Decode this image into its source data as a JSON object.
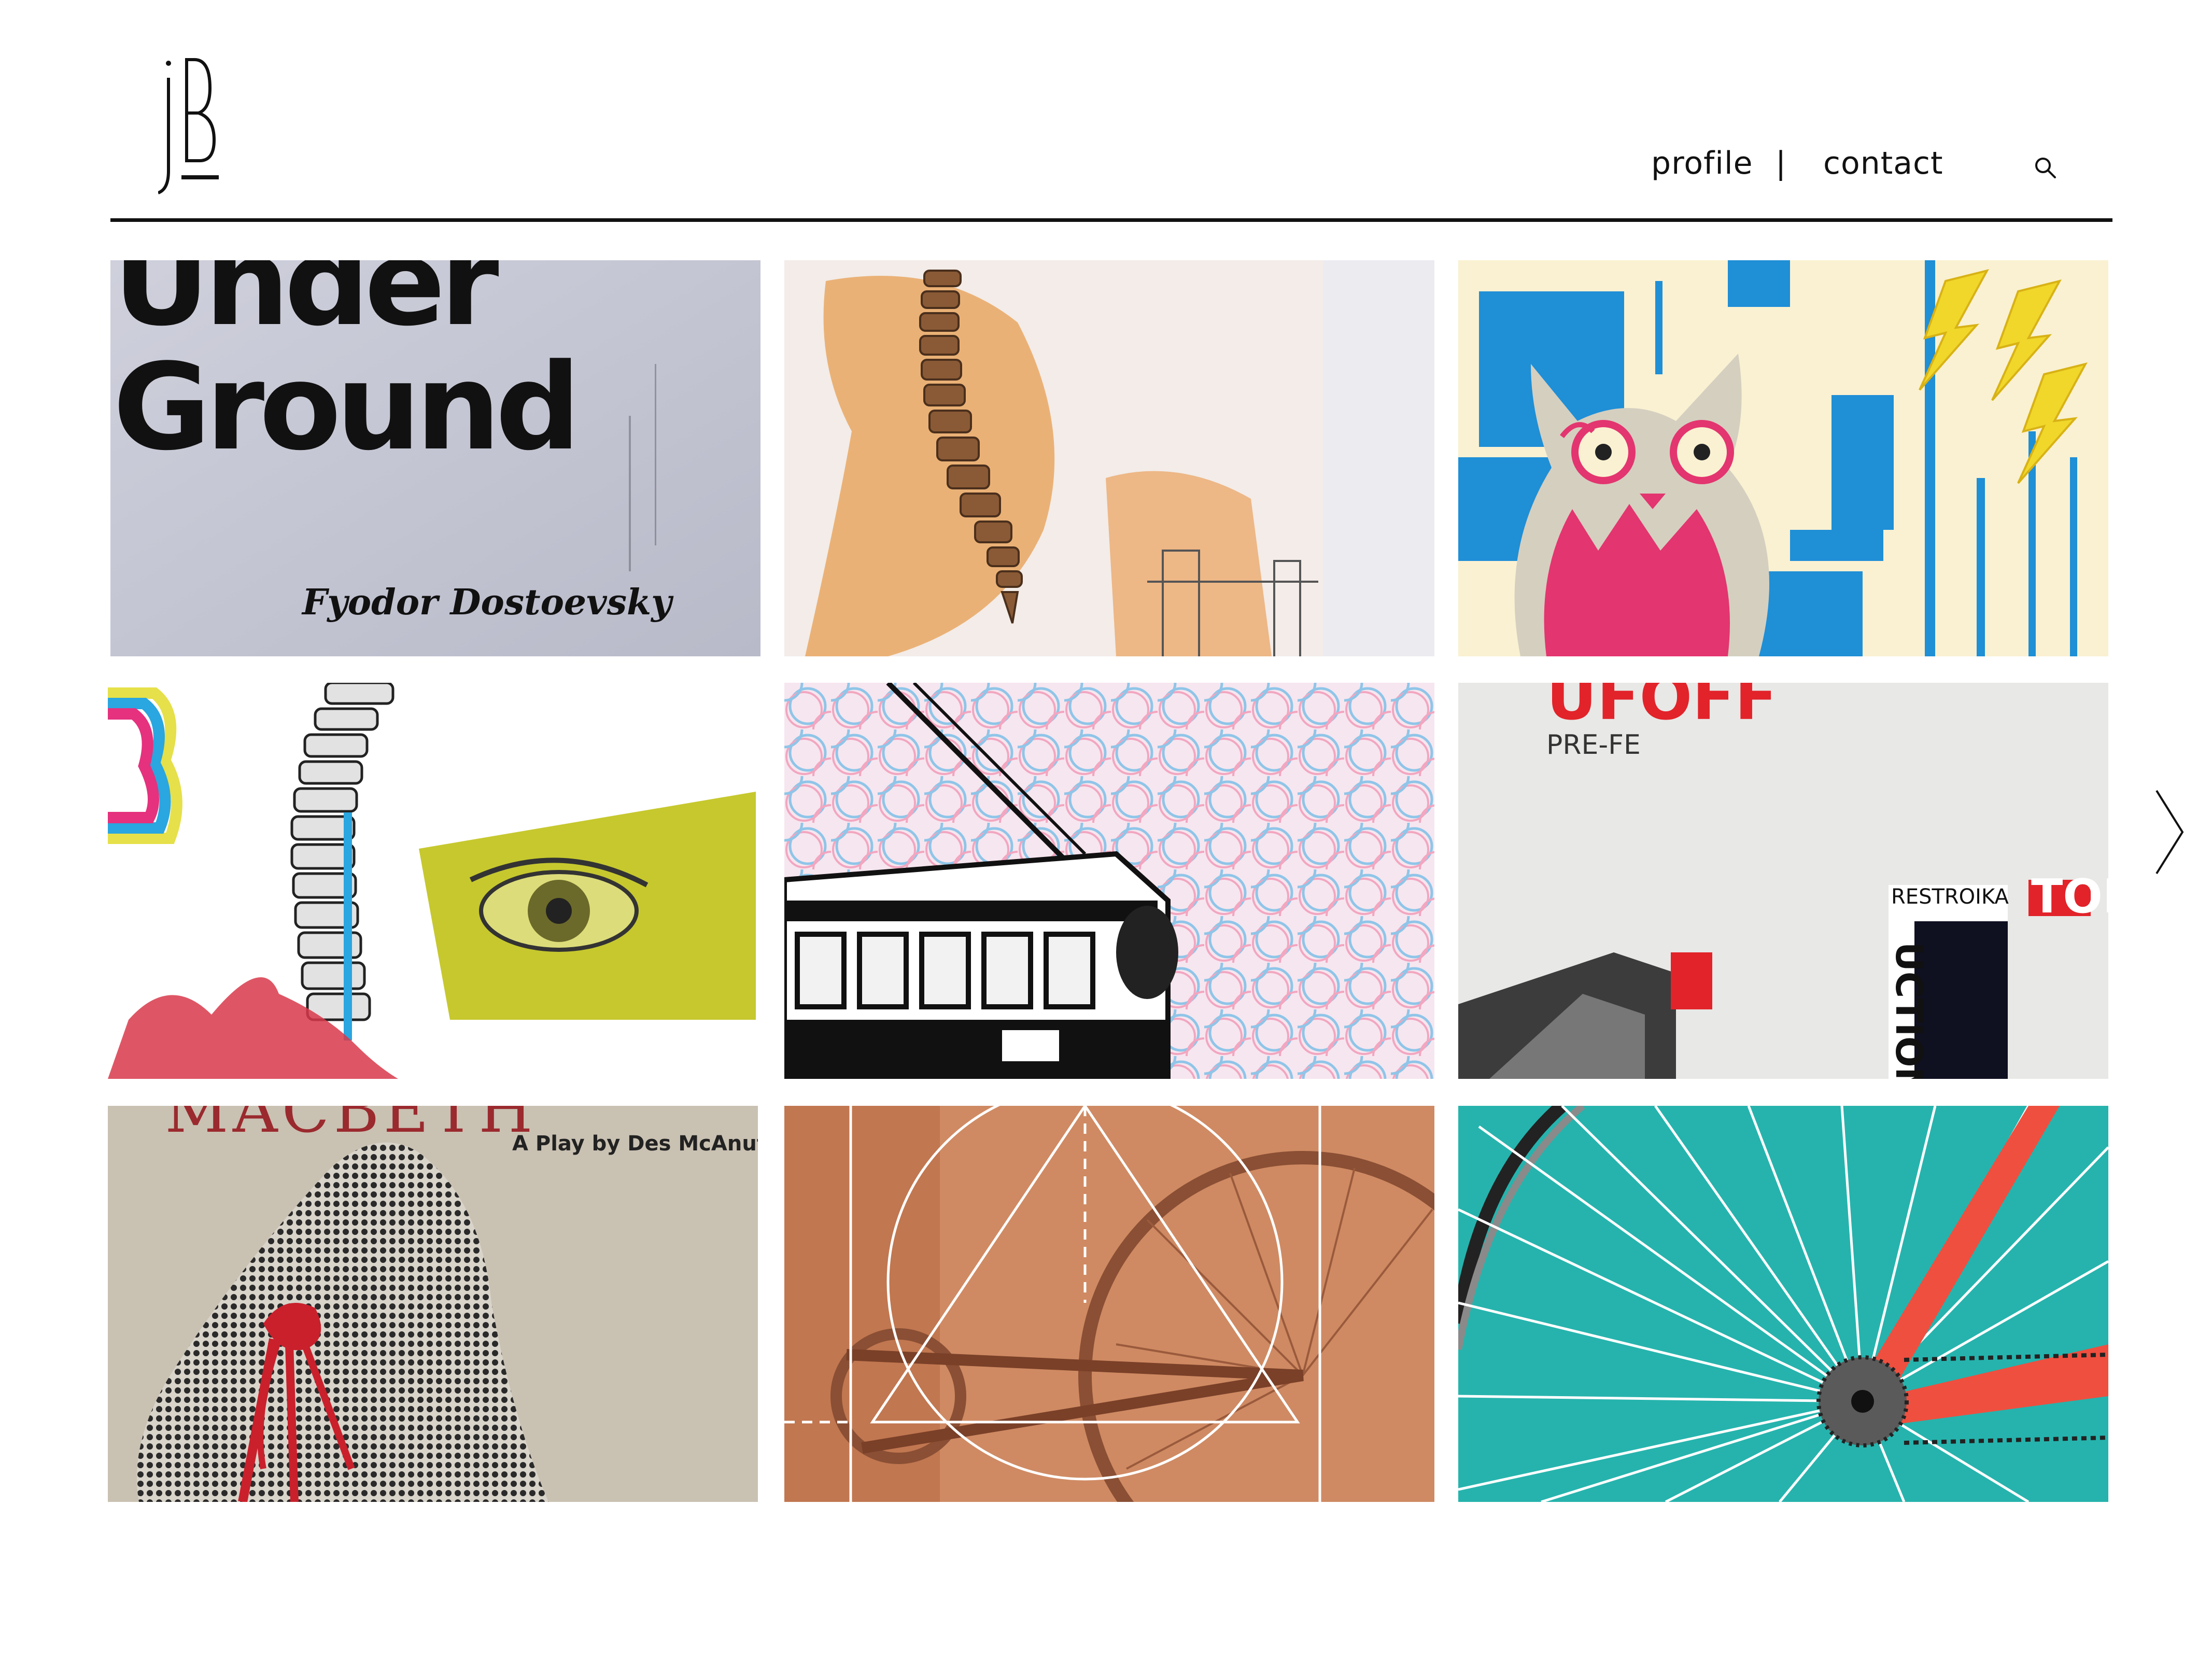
{
  "site": {
    "logo_text": "jB"
  },
  "nav": {
    "profile_label": "profile",
    "separator": "|",
    "contact_label": "contact",
    "search_icon": "search-icon"
  },
  "colors": {
    "text": "#111111",
    "rule": "#111111",
    "background": "#ffffff"
  },
  "gallery": {
    "tiles": [
      {
        "id": "underground",
        "lines": [
          "Under",
          "Ground"
        ],
        "author": "Fyodor Dostoevsky"
      },
      {
        "id": "spine-anatomy"
      },
      {
        "id": "cat-circuit"
      },
      {
        "id": "spine-eye"
      },
      {
        "id": "trolley-pattern"
      },
      {
        "id": "typographic-collage",
        "text_a": "UFOFF",
        "text_b": "PRE-FE",
        "text_c": "RESTROIKA",
        "text_d": "UCTION",
        "text_e": "TOL"
      },
      {
        "id": "macbeth",
        "title": "MACBETH",
        "subtitle": "A Play by Des McAnuff"
      },
      {
        "id": "bicycle-geometry"
      },
      {
        "id": "bicycle-wheel"
      }
    ],
    "next_icon": "chevron-right-icon"
  }
}
